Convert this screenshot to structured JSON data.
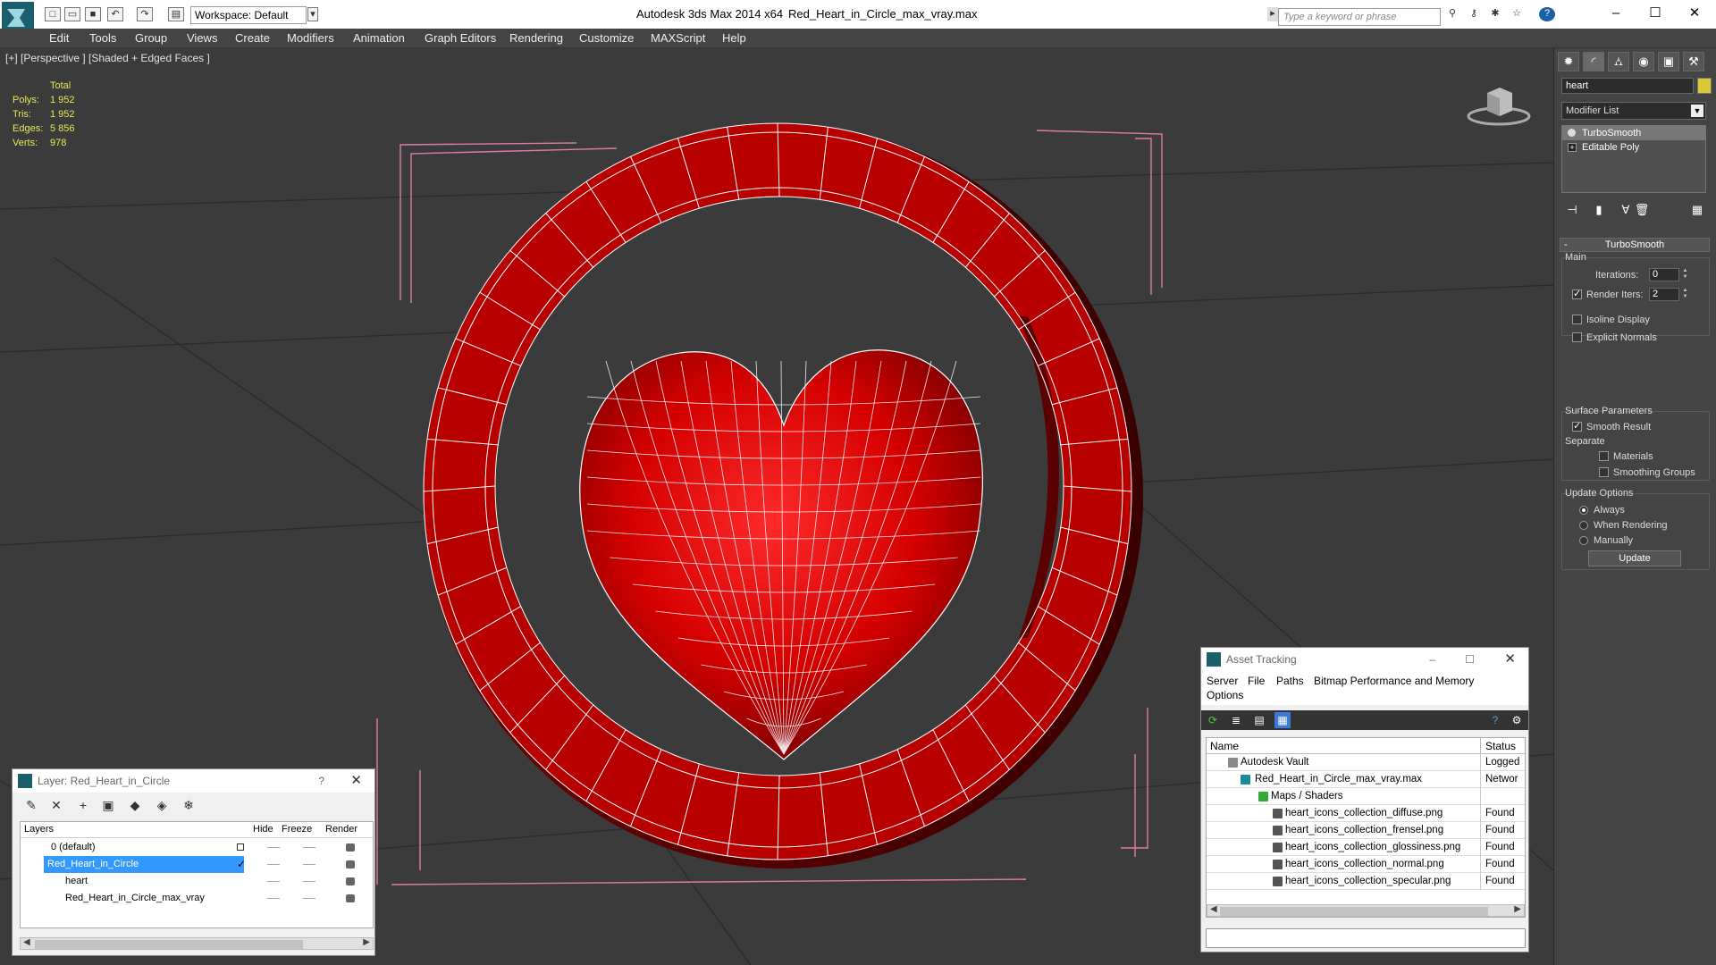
{
  "titlebar": {
    "workspace": "Workspace: Default",
    "app_title": "Autodesk 3ds Max  2014 x64",
    "file_name": "Red_Heart_in_Circle_max_vray.max",
    "search_placeholder": "Type a keyword or phrase"
  },
  "menu": [
    "Edit",
    "Tools",
    "Group",
    "Views",
    "Create",
    "Modifiers",
    "Animation",
    "Graph Editors",
    "Rendering",
    "Customize",
    "MAXScript",
    "Help"
  ],
  "viewport": {
    "label": "[+] [Perspective ] [Shaded + Edged Faces ]",
    "stats_header": "Total",
    "stats": [
      {
        "key": "Polys:",
        "value": "1 952"
      },
      {
        "key": "Tris:",
        "value": "1 952"
      },
      {
        "key": "Edges:",
        "value": "5 856"
      },
      {
        "key": "Verts:",
        "value": "978"
      }
    ],
    "colors": {
      "background": "#3b3b3b",
      "mesh": "#b30000",
      "bbox": "#e07aa8",
      "wire": "#ffffff"
    }
  },
  "command_panel": {
    "object_name": "heart",
    "modifier_list": "Modifier List",
    "stack": [
      {
        "label": "TurboSmooth",
        "selected": true
      },
      {
        "label": "Editable Poly",
        "selected": false
      }
    ],
    "rollout_title": "TurboSmooth",
    "main_group": "Main",
    "iterations_label": "Iterations:",
    "iterations_value": "0",
    "render_iters_label": "Render Iters:",
    "render_iters_value": "2",
    "isoline_label": "Isoline Display",
    "explicit_normals_label": "Explicit Normals",
    "surface_params": "Surface Parameters",
    "smooth_result": "Smooth Result",
    "separate": "Separate",
    "materials": "Materials",
    "smoothing_groups": "Smoothing Groups",
    "update_options": "Update Options",
    "always": "Always",
    "when_rendering": "When Rendering",
    "manually": "Manually",
    "update_button": "Update"
  },
  "layer_window": {
    "title": "Layer: Red_Heart_in_Circle",
    "help": "?",
    "columns": [
      "Layers",
      "Hide",
      "Freeze",
      "Render"
    ],
    "rows": [
      {
        "name": "0 (default)"
      },
      {
        "name": "Red_Heart_in_Circle"
      },
      {
        "name": "heart"
      },
      {
        "name": "Red_Heart_in_Circle_max_vray"
      }
    ]
  },
  "asset_window": {
    "title": "Asset Tracking",
    "menu": [
      "Server",
      "File",
      "Paths",
      "Bitmap Performance and Memory",
      "Options"
    ],
    "columns": [
      "Name",
      "Status"
    ],
    "rows": [
      {
        "name": "Autodesk Vault",
        "status": "Logged"
      },
      {
        "name": "Red_Heart_in_Circle_max_vray.max",
        "status": "Networ"
      },
      {
        "name": "Maps / Shaders",
        "status": ""
      },
      {
        "name": "heart_icons_collection_diffuse.png",
        "status": "Found"
      },
      {
        "name": "heart_icons_collection_frensel.png",
        "status": "Found"
      },
      {
        "name": "heart_icons_collection_glossiness.png",
        "status": "Found"
      },
      {
        "name": "heart_icons_collection_normal.png",
        "status": "Found"
      },
      {
        "name": "heart_icons_collection_specular.png",
        "status": "Found"
      }
    ]
  }
}
